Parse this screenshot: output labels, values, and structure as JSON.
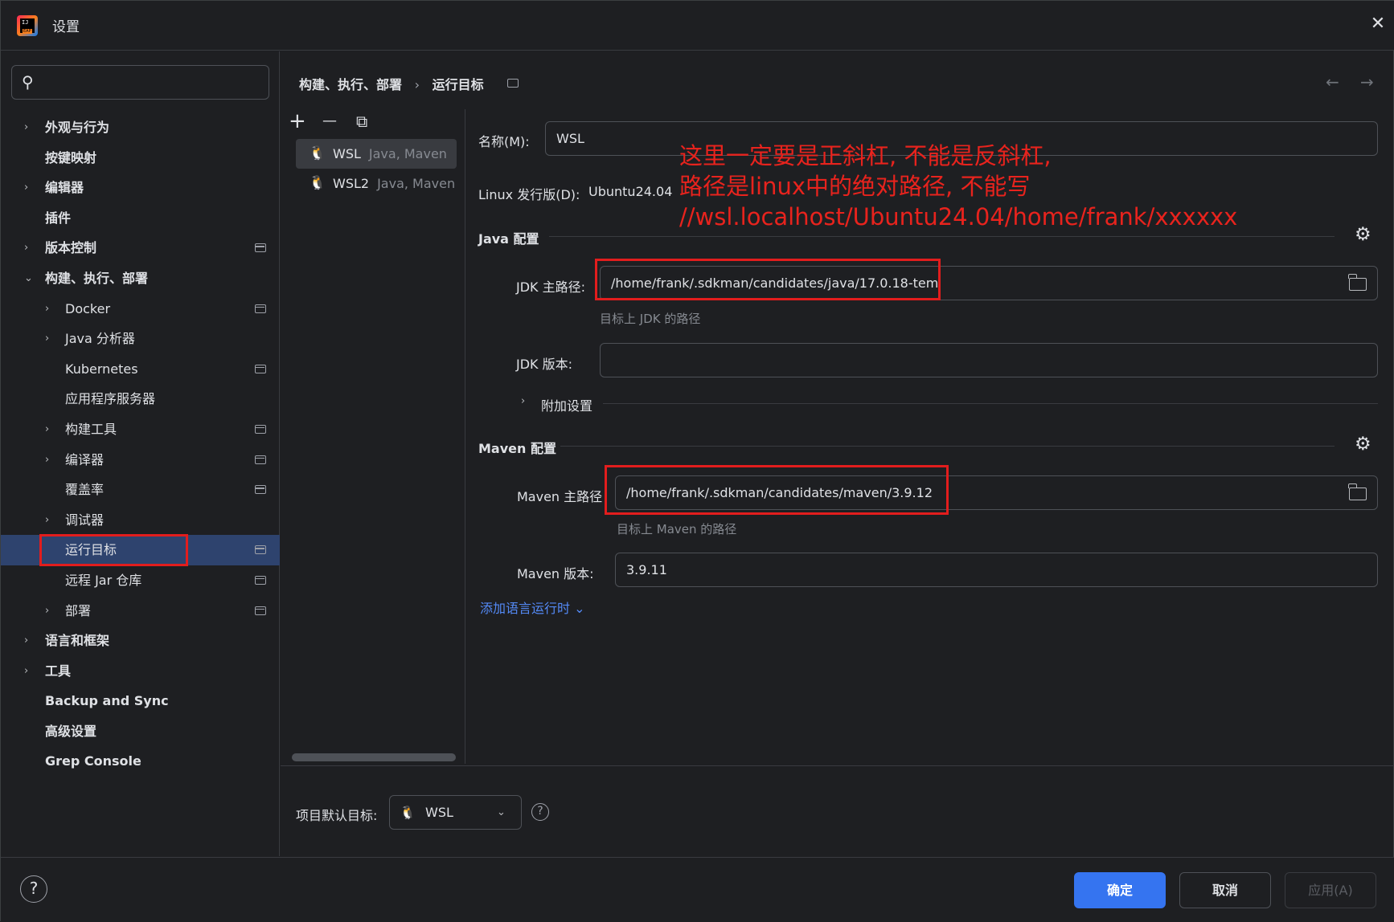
{
  "window": {
    "title": "设置",
    "close_glyph": "✕"
  },
  "search": {
    "placeholder": "",
    "icon": "search-icon"
  },
  "sidebar": {
    "items": [
      {
        "label": "外观与行为",
        "chevron": "›",
        "bold": true,
        "indent": 0
      },
      {
        "label": "按键映射",
        "chevron": "",
        "bold": true,
        "indent": 0
      },
      {
        "label": "编辑器",
        "chevron": "›",
        "bold": true,
        "indent": 0
      },
      {
        "label": "插件",
        "chevron": "",
        "bold": true,
        "indent": 0
      },
      {
        "label": "版本控制",
        "chevron": "›",
        "bold": true,
        "indent": 0,
        "page_icon": true
      },
      {
        "label": "构建、执行、部署",
        "chevron": "⌄",
        "bold": true,
        "indent": 0
      },
      {
        "label": "Docker",
        "chevron": "›",
        "indent": 1,
        "page_icon": true
      },
      {
        "label": "Java 分析器",
        "chevron": "›",
        "indent": 1
      },
      {
        "label": "Kubernetes",
        "chevron": "",
        "indent": 1,
        "page_icon": true
      },
      {
        "label": "应用程序服务器",
        "chevron": "",
        "indent": 1
      },
      {
        "label": "构建工具",
        "chevron": "›",
        "indent": 1,
        "page_icon": true
      },
      {
        "label": "编译器",
        "chevron": "›",
        "indent": 1,
        "page_icon": true
      },
      {
        "label": "覆盖率",
        "chevron": "",
        "indent": 1,
        "page_icon": true
      },
      {
        "label": "调试器",
        "chevron": "›",
        "indent": 1
      },
      {
        "label": "运行目标",
        "chevron": "",
        "indent": 1,
        "page_icon": true,
        "selected": true
      },
      {
        "label": "远程 Jar 仓库",
        "chevron": "",
        "indent": 1,
        "page_icon": true
      },
      {
        "label": "部署",
        "chevron": "›",
        "indent": 1,
        "page_icon": true
      },
      {
        "label": "语言和框架",
        "chevron": "›",
        "bold": true,
        "indent": 0
      },
      {
        "label": "工具",
        "chevron": "›",
        "bold": true,
        "indent": 0
      },
      {
        "label": "Backup and Sync",
        "chevron": "",
        "bold": true,
        "indent": 0
      },
      {
        "label": "高级设置",
        "chevron": "",
        "bold": true,
        "indent": 0
      },
      {
        "label": "Grep Console",
        "chevron": "",
        "bold": true,
        "indent": 0
      }
    ]
  },
  "breadcrumb": {
    "parent": "构建、执行、部署",
    "separator": "›",
    "current": "运行目标"
  },
  "nav": {
    "back": "←",
    "forward": "→"
  },
  "targets_toolbar": {
    "add": "+",
    "remove": "—",
    "copy": "⧉"
  },
  "targets": [
    {
      "name": "WSL",
      "type": "Java, Maven",
      "selected": true
    },
    {
      "name": "WSL2",
      "type": "Java, Maven",
      "selected": false
    }
  ],
  "form": {
    "name_label": "名称(M):",
    "name_value": "WSL",
    "distro_label": "Linux 发行版(D):",
    "distro_value": "Ubuntu24.04",
    "java_section": "Java 配置",
    "jdk_home_label": "JDK 主路径:",
    "jdk_home_value": "/home/frank/.sdkman/candidates/java/17.0.18-tem",
    "jdk_home_hint": "目标上 JDK 的路径",
    "jdk_version_label": "JDK 版本:",
    "jdk_version_value": "",
    "extra_settings": "附加设置",
    "maven_section": "Maven 配置",
    "maven_home_label": "Maven 主路径",
    "maven_home_value": "/home/frank/.sdkman/candidates/maven/3.9.12",
    "maven_home_hint": "目标上 Maven 的路径",
    "maven_version_label": "Maven 版本:",
    "maven_version_value": "3.9.11",
    "add_runtime_link": "添加语言运行时 ⌄"
  },
  "annotation": {
    "line1": "这里一定要是正斜杠, 不能是反斜杠,",
    "line2": "路径是linux中的绝对路径, 不能写",
    "line3": "//wsl.localhost/Ubuntu24.04/home/frank/xxxxxx",
    "color": "#e8231d"
  },
  "default_target": {
    "label": "项目默认目标:",
    "value": "WSL",
    "help": "?"
  },
  "footer": {
    "help": "?",
    "ok": "确定",
    "cancel": "取消",
    "apply": "应用(A)"
  },
  "colors": {
    "accent": "#3574f0",
    "selection": "#2e436e",
    "annotation_red": "#e21d1d"
  }
}
